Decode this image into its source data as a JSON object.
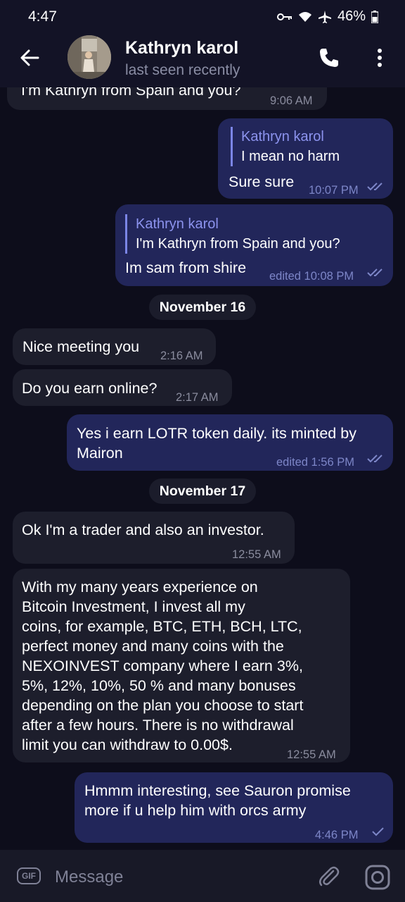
{
  "status_bar": {
    "time": "4:47",
    "battery": "46%"
  },
  "header": {
    "name": "Kathryn karol",
    "status": "last seen recently"
  },
  "messages": [
    {
      "text": "I'm Kathryn from Spain and you?",
      "time": "9:06 AM"
    },
    {
      "quote_name": "Kathryn karol",
      "quote_text": "I mean no harm",
      "text": "Sure sure",
      "time": "10:07 PM"
    },
    {
      "quote_name": "Kathryn karol",
      "quote_text": "I'm Kathryn from Spain and you?",
      "text": "Im sam from shire",
      "time": "edited 10:08 PM"
    },
    {
      "date": "November 16"
    },
    {
      "text": "Nice meeting you",
      "time": "2:16 AM"
    },
    {
      "text": "Do you earn online?",
      "time": "2:17 AM"
    },
    {
      "line1": "Yes i earn LOTR token daily. its minted by",
      "line2": "Mairon",
      "time": "edited 1:56 PM"
    },
    {
      "date": "November 17"
    },
    {
      "text": "Ok I'm a trader and also an investor.",
      "time": "12:55 AM"
    },
    {
      "lines": [
        "With my many years experience on",
        "Bitcoin Investment, I invest all my",
        "coins, for example, BTC, ETH, BCH, LTC,",
        "perfect money and many coins with the",
        "NEXOINVEST company where I earn 3%,",
        "5%, 12%, 10%, 50 % and many bonuses",
        "depending on the plan you choose to start",
        "after a few hours.  There is no withdrawal",
        "limit you can withdraw to 0.00$."
      ],
      "time": "12:55 AM"
    },
    {
      "line1": "Hmmm interesting, see Sauron promise",
      "line2": "more if u help him with orcs army",
      "time": "4:46 PM"
    }
  ],
  "input": {
    "gif_label": "GIF",
    "placeholder": "Message"
  },
  "icons": [
    "back-arrow-icon",
    "phone-icon",
    "more-vertical-icon",
    "gif-icon",
    "paperclip-icon",
    "instagram-icon",
    "double-check-icon",
    "check-icon",
    "wifi-icon",
    "airplane-icon",
    "battery-icon",
    "key-icon"
  ],
  "colors": {
    "background": "#0d0d1b",
    "incoming_bubble": "#1d1e2c",
    "outgoing_bubble": "#22265a",
    "accent": "#8c93ee"
  }
}
